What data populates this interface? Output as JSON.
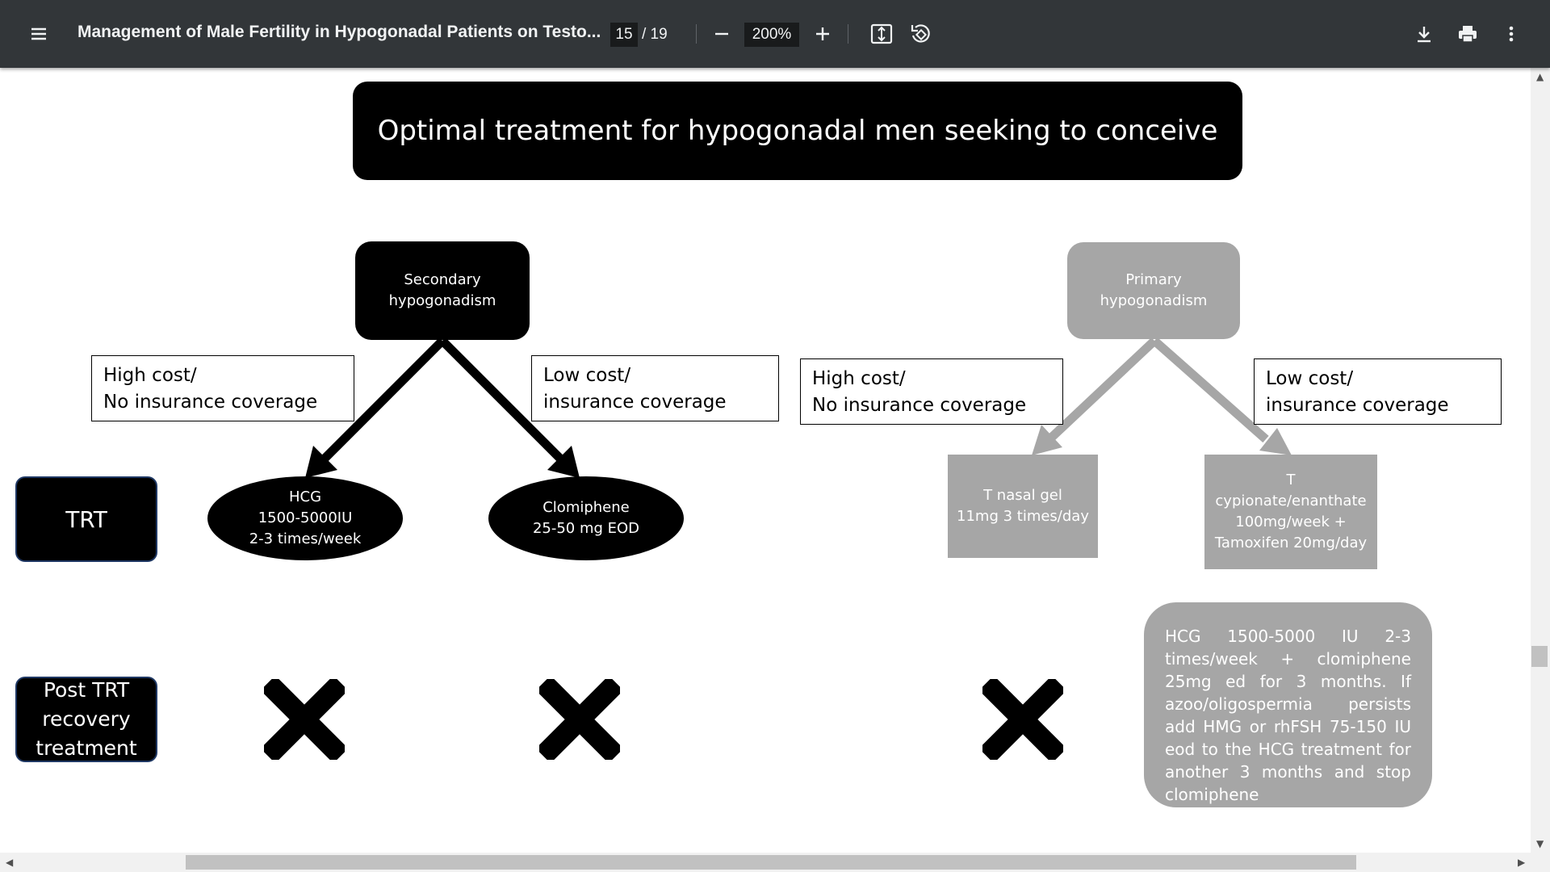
{
  "toolbar": {
    "document_title": "Management of Male Fertility in Hypogonadal Patients on Testo...",
    "current_page": "15",
    "page_total": "/ 19",
    "zoom": "200%",
    "icons": {
      "menu": "menu-icon",
      "zoom_out": "minus-icon",
      "zoom_in": "plus-icon",
      "fit": "fit-to-page-icon",
      "rotate": "rotate-icon",
      "download": "download-icon",
      "print": "print-icon",
      "more": "more-vert-icon"
    }
  },
  "slide": {
    "title": "Optimal treatment for hypogonadal men seeking to conceive",
    "secondary": {
      "node": [
        "Secondary",
        "hypogonadism"
      ],
      "high_cost": [
        "High cost/",
        "No insurance coverage"
      ],
      "low_cost": [
        "Low cost/",
        "insurance coverage"
      ],
      "hcg": [
        "HCG",
        "1500-5000IU",
        "2-3 times/week"
      ],
      "clomiphene": [
        "Clomiphene",
        "25-50 mg EOD"
      ]
    },
    "primary": {
      "node": [
        "Primary",
        "hypogonadism"
      ],
      "high_cost": [
        "High cost/",
        "No insurance coverage"
      ],
      "low_cost": [
        "Low cost/",
        "insurance coverage"
      ],
      "nasal_gel": [
        "T nasal gel",
        "11mg 3 times/day"
      ],
      "cypionate": [
        "T",
        "cypionate/enanthate",
        "100mg/week +",
        "Tamoxifen 20mg/day"
      ]
    },
    "rows": {
      "trt": "TRT",
      "post_trt": [
        "Post TRT",
        "recovery",
        "treatment"
      ]
    },
    "hcg_recovery_note": "HCG 1500-5000 IU 2-3 times/week + clomiphene 25mg ed for 3 months. If azoo/oligospermia persists add HMG or rhFSH 75-150 IU eod to the HCG treatment for another 3 months and stop clomiphene",
    "colors": {
      "dark": "#000000",
      "grey": "#a6a6a6",
      "row_border": "#1f3864"
    }
  }
}
